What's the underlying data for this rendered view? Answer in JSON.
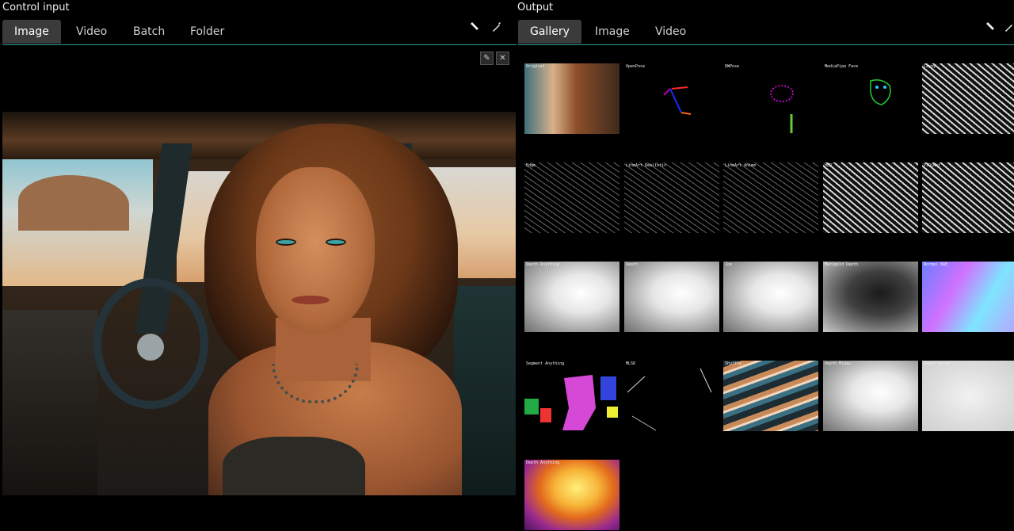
{
  "left_panel": {
    "title": "Control input",
    "tabs": [
      "Image",
      "Video",
      "Batch",
      "Folder"
    ],
    "active_tab": "Image",
    "edit_glyph": "✎",
    "close_glyph": "✕"
  },
  "right_panel": {
    "title": "Output",
    "tabs": [
      "Gallery",
      "Image",
      "Video"
    ],
    "active_tab": "Gallery",
    "thumbnails": [
      {
        "caption": "Original",
        "style": "orig"
      },
      {
        "caption": "OpenPose",
        "style": "pose"
      },
      {
        "caption": "DWPose",
        "style": "dwpose"
      },
      {
        "caption": "MediaPipe Face",
        "style": "face"
      },
      {
        "caption": "Canny",
        "style": "edge-strong"
      },
      {
        "caption": "Edge",
        "style": "edge"
      },
      {
        "caption": "LineArt Realistic",
        "style": "edge"
      },
      {
        "caption": "LineArt Anime",
        "style": "edge"
      },
      {
        "caption": "HED",
        "style": "edge-strong"
      },
      {
        "caption": "PiDiNet",
        "style": "edge-strong"
      },
      {
        "caption": "Depth Anything",
        "style": "depth"
      },
      {
        "caption": "Depth",
        "style": "depth"
      },
      {
        "caption": "Zoe",
        "style": "depth"
      },
      {
        "caption": "Marigold Depth",
        "style": "depth-dark"
      },
      {
        "caption": "Normal BAE",
        "style": "normal"
      },
      {
        "caption": "Segment Anything",
        "style": "seg"
      },
      {
        "caption": "MLSD",
        "style": "mlsd"
      },
      {
        "caption": "Shuffle",
        "style": "shuffle"
      },
      {
        "caption": "Depth Midas",
        "style": "depth"
      },
      {
        "caption": "Depth Leres",
        "style": "light"
      },
      {
        "caption": "Depth Anything",
        "style": "magma"
      }
    ]
  },
  "colors": {
    "accent_line": "#2a9d9c",
    "active_tab_bg": "#3b3b3b",
    "background": "#000000"
  },
  "icons": [
    "pencil-icon",
    "brush-icon",
    "edit-icon",
    "close-icon"
  ]
}
